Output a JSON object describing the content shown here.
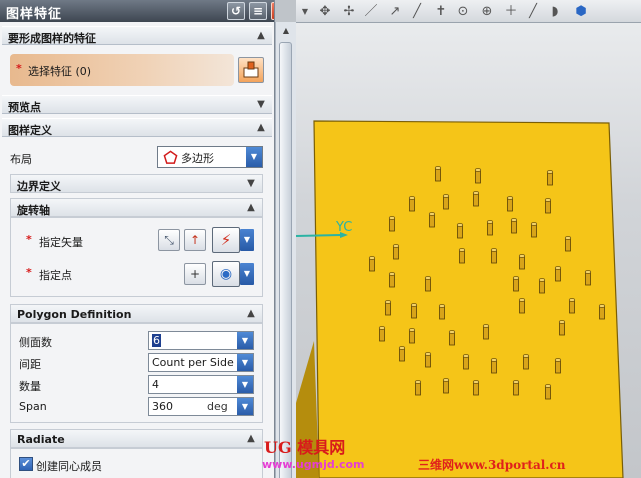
{
  "dialog": {
    "title": "图样特征",
    "icons": {
      "reset": "reset-icon",
      "menu": "menu-icon",
      "close": "close-icon"
    }
  },
  "sections": {
    "feature": {
      "title": "要形成图样的特征",
      "select_label": "选择特征 (0)"
    },
    "preview": {
      "title": "预览点"
    },
    "pattern_def": {
      "title": "图样定义",
      "layout_label": "布局",
      "layout_value": "多边形",
      "boundary": {
        "title": "边界定义"
      },
      "rotation_axis": {
        "title": "旋转轴",
        "vector_label": "指定矢量",
        "point_label": "指定点"
      },
      "polygon": {
        "title": "Polygon Definition",
        "sides_label": "侧面数",
        "sides_value": "6",
        "spacing_label": "间距",
        "spacing_value": "Count per Side",
        "count_label": "数量",
        "count_value": "4",
        "span_label": "Span",
        "span_value": "360",
        "span_unit": "deg"
      },
      "radiate": {
        "title": "Radiate",
        "concentric_label": "创建同心成员",
        "concentric_checked": true
      }
    }
  },
  "required_mark": "*",
  "viewport": {
    "axis_label": "YC",
    "block_color": "#f5c518",
    "pin_color": "#d8a41a"
  },
  "watermarks": {
    "ug_text": "UG 模具网",
    "ug_url": "www.ugmjd.com",
    "portal": "三维网www.3dportal.cn"
  }
}
